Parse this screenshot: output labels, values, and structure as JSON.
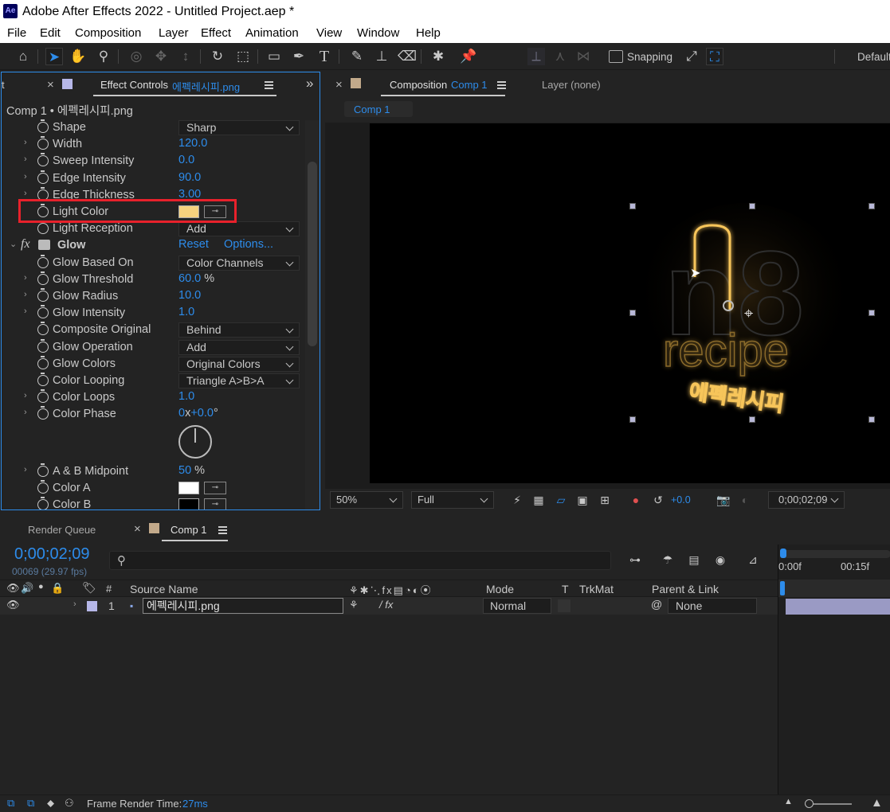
{
  "app": {
    "logo": "Ae",
    "title": "Adobe After Effects 2022 - Untitled Project.aep *"
  },
  "menu": [
    "File",
    "Edit",
    "Composition",
    "Layer",
    "Effect",
    "Animation",
    "View",
    "Window",
    "Help"
  ],
  "toolbar": {
    "snapping_label": "Snapping",
    "workspace_label": "Default"
  },
  "effect_controls": {
    "tab_prefix": "Effect Controls",
    "tab_file": "에펙레시피.png",
    "subtitle": "Comp 1 • 에펙레시피.png",
    "highlight_color": "#e8212b",
    "rows": [
      {
        "name": "Shape",
        "kind": "dropdown",
        "value": "Sharp",
        "twirl": false
      },
      {
        "name": "Width",
        "kind": "number",
        "value": "120.0",
        "twirl": true
      },
      {
        "name": "Sweep Intensity",
        "kind": "number",
        "value": "0.0",
        "twirl": true
      },
      {
        "name": "Edge Intensity",
        "kind": "number",
        "value": "90.0",
        "twirl": true
      },
      {
        "name": "Edge Thickness",
        "kind": "number",
        "value": "3.00",
        "twirl": true
      },
      {
        "name": "Light Color",
        "kind": "color",
        "color": "#f6d27e",
        "twirl": false
      },
      {
        "name": "Light Reception",
        "kind": "dropdown",
        "value": "Add",
        "twirl": false
      }
    ],
    "glow": {
      "fx_label": "fx",
      "name": "Glow",
      "reset_label": "Reset",
      "options_label": "Options...",
      "rows": [
        {
          "name": "Glow Based On",
          "kind": "dropdown",
          "value": "Color Channels",
          "twirl": false
        },
        {
          "name": "Glow Threshold",
          "kind": "number",
          "value": "60.0",
          "unit": "%",
          "twirl": true
        },
        {
          "name": "Glow Radius",
          "kind": "number",
          "value": "10.0",
          "twirl": true
        },
        {
          "name": "Glow Intensity",
          "kind": "number",
          "value": "1.0",
          "twirl": true
        },
        {
          "name": "Composite Original",
          "kind": "dropdown",
          "value": "Behind",
          "twirl": false
        },
        {
          "name": "Glow Operation",
          "kind": "dropdown",
          "value": "Add",
          "twirl": false
        },
        {
          "name": "Glow Colors",
          "kind": "dropdown",
          "value": "Original Colors",
          "twirl": false
        },
        {
          "name": "Color Looping",
          "kind": "dropdown",
          "value": "Triangle A>B>A",
          "twirl": false
        },
        {
          "name": "Color Loops",
          "kind": "number",
          "value": "1.0",
          "twirl": true
        },
        {
          "name": "Color Phase",
          "kind": "phase",
          "value_rev": "0",
          "value_x": "x",
          "value_deg": "+0.0",
          "unit": "°",
          "twirl": true
        },
        {
          "name": "A & B Midpoint",
          "kind": "number",
          "value": "50",
          "unit": "%",
          "twirl": true
        },
        {
          "name": "Color A",
          "kind": "color",
          "color": "#ffffff",
          "twirl": false
        },
        {
          "name": "Color B",
          "kind": "color",
          "color": "#000000",
          "twirl": false
        }
      ]
    }
  },
  "composition": {
    "tab_prefix": "Composition",
    "tab_comp": "Comp 1",
    "layer_label": "Layer (none)",
    "subtab": "Comp 1",
    "viewer": {
      "logo_letters": "n8",
      "logo_word": "recipe",
      "logo_korean": "에펙레시피",
      "glow_color": "#f7c55a"
    },
    "bar": {
      "zoom": "50%",
      "resolution": "Full",
      "exposure": "+0.0",
      "timecode": "0;00;02;09"
    }
  },
  "timeline": {
    "render_queue_label": "Render Queue",
    "comp_tab": "Comp 1",
    "timecode": "0;00;02;09",
    "frame_info": "00069 (29.97 fps)",
    "columns": {
      "num": "#",
      "source": "Source Name",
      "mode": "Mode",
      "t": "T",
      "trkmat": "TrkMat",
      "parent": "Parent & Link"
    },
    "ruler": [
      "0:00f",
      "00:15f"
    ],
    "layer": {
      "index": "1",
      "name": "에펙레시피.png",
      "mode": "Normal",
      "parent": "None",
      "label_color": "#b6b7e8",
      "bar_color": "#9a9ac4"
    }
  },
  "status": {
    "frame_render_label": "Frame Render Time:",
    "frame_render_value": "27ms",
    "value_color": "#2d8ceb"
  }
}
